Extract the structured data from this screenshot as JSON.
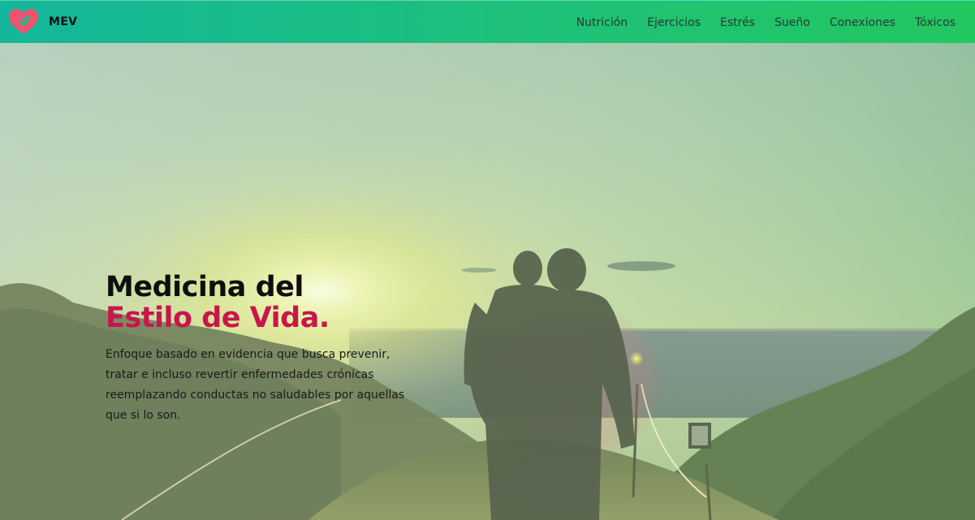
{
  "brand": {
    "name": "MEV",
    "logo_icon": "heart-leaf-icon",
    "logo_color": "#f0536f"
  },
  "nav": {
    "links": [
      {
        "label": "Nutrición"
      },
      {
        "label": "Ejercicios"
      },
      {
        "label": "Estrés"
      },
      {
        "label": "Sueño"
      },
      {
        "label": "Conexiones"
      },
      {
        "label": "Tóxicos"
      }
    ],
    "gradient_start": "#14b69b",
    "gradient_end": "#22c760"
  },
  "hero": {
    "title_line1": "Medicina del",
    "title_line2": "Estilo de Vida.",
    "title_accent_color": "#c8164c",
    "description": "Enfoque basado en evidencia que busca prevenir, tratar e incluso revertir enfermedades crónicas reemplazando conductas no saludables por aquellas que si lo son.",
    "background": "sunset-coastal-walk-image"
  }
}
